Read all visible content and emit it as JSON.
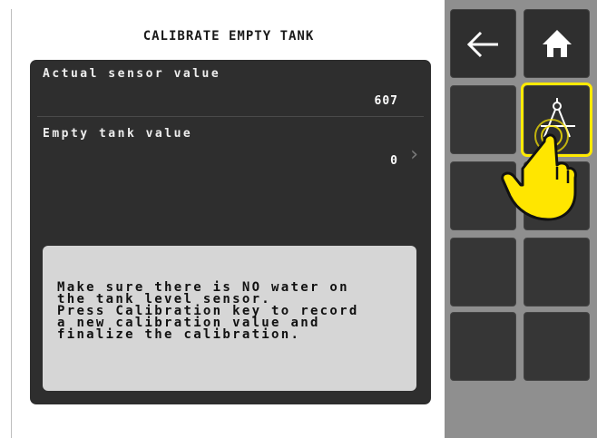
{
  "screen": {
    "title": "CALIBRATE EMPTY TANK"
  },
  "fields": [
    {
      "label": "Actual sensor value",
      "value": "607",
      "has_chevron": false
    },
    {
      "label": "Empty tank value",
      "value": "0",
      "has_chevron": true
    }
  ],
  "info": {
    "lines": [
      "Make sure there is NO water on",
      "the tank level sensor.",
      "Press Calibration key to record",
      "a new calibration value and",
      "finalize the calibration."
    ]
  },
  "softkeys": [
    {
      "name": "back-key",
      "icon": "back-arrow-icon"
    },
    {
      "name": "home-key",
      "icon": "home-icon"
    },
    {
      "name": "empty-key-r2-left",
      "icon": ""
    },
    {
      "name": "calibration-key",
      "icon": "compass-calibration-icon",
      "highlighted": true
    },
    {
      "name": "empty-key-r3-left",
      "icon": ""
    },
    {
      "name": "empty-key-r3-right",
      "icon": ""
    },
    {
      "name": "empty-key-r4-left",
      "icon": ""
    },
    {
      "name": "empty-key-r4-right",
      "icon": ""
    },
    {
      "name": "empty-key-r5-left",
      "icon": ""
    },
    {
      "name": "empty-key-r5-right",
      "icon": ""
    }
  ],
  "colors": {
    "panel": "#2e2e2e",
    "info_box": "#d6d6d6",
    "sidebar": "#8f8f8f",
    "key": "#2f2f2f",
    "highlight": "#ffea00"
  }
}
